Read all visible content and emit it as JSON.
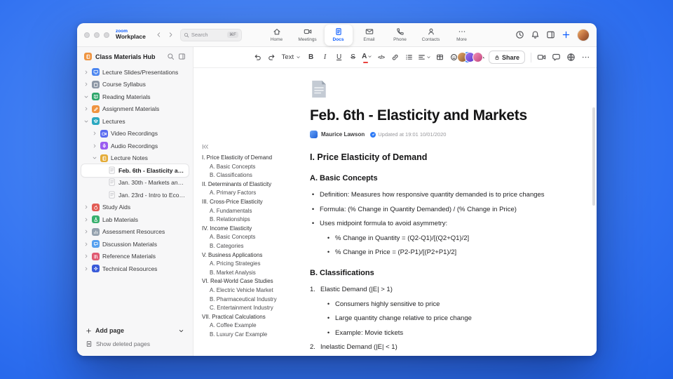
{
  "titlebar": {
    "brand_top": "zoom",
    "brand_bottom": "Workplace",
    "search": {
      "placeholder": "Search",
      "shortcut": "⌘F"
    },
    "tabs": [
      {
        "label": "Home",
        "icon": "home",
        "active": false
      },
      {
        "label": "Meetings",
        "icon": "meetings",
        "active": false
      },
      {
        "label": "Docs",
        "icon": "docs",
        "active": true
      },
      {
        "label": "Email",
        "icon": "email",
        "active": false
      },
      {
        "label": "Phone",
        "icon": "phone",
        "active": false
      },
      {
        "label": "Contacts",
        "icon": "contacts",
        "active": false
      },
      {
        "label": "More",
        "icon": "more",
        "active": false
      }
    ],
    "right_icons": [
      "history",
      "bell",
      "panel",
      "plus"
    ]
  },
  "sidebar": {
    "title": "Class Materials Hub",
    "items": [
      {
        "label": "Lecture Slides/Presentations",
        "indent": 0,
        "chevron": "right",
        "icon": {
          "kind": "monitor",
          "color": "#4c86f0"
        }
      },
      {
        "label": "Course Syllabus",
        "indent": 0,
        "chevron": "right",
        "icon": {
          "kind": "clipboard",
          "color": "#8d97a5"
        }
      },
      {
        "label": "Reading Materials",
        "indent": 0,
        "chevron": "down",
        "icon": {
          "kind": "book",
          "color": "#2ea66b"
        }
      },
      {
        "label": "Assignment Materials",
        "indent": 0,
        "chevron": "right",
        "icon": {
          "kind": "pencil",
          "color": "#ef9440"
        }
      },
      {
        "label": "Lectures",
        "indent": 0,
        "chevron": "down",
        "icon": {
          "kind": "cap",
          "color": "#2ba8c0"
        }
      },
      {
        "label": "Video Recordings",
        "indent": 1,
        "chevron": "right",
        "icon": {
          "kind": "camera",
          "color": "#5a6cf0"
        }
      },
      {
        "label": "Audio Recordings",
        "indent": 1,
        "chevron": "right",
        "icon": {
          "kind": "mic",
          "color": "#9a5cf0"
        }
      },
      {
        "label": "Lecture Notes",
        "indent": 1,
        "chevron": "down",
        "icon": {
          "kind": "notebook",
          "color": "#e4ac38"
        }
      },
      {
        "label": "Feb. 6th - Elasticity and M...",
        "indent": 2,
        "chevron": "none",
        "selected": true,
        "icon": {
          "kind": "page"
        }
      },
      {
        "label": "Jan. 30th - Markets and P...",
        "indent": 2,
        "chevron": "none",
        "icon": {
          "kind": "page"
        }
      },
      {
        "label": "Jan. 23rd - Intro to Econo...",
        "indent": 2,
        "chevron": "none",
        "icon": {
          "kind": "page"
        }
      },
      {
        "label": "Study Aids",
        "indent": 0,
        "chevron": "right",
        "icon": {
          "kind": "apple",
          "color": "#e25c55"
        }
      },
      {
        "label": "Lab Materials",
        "indent": 0,
        "chevron": "right",
        "icon": {
          "kind": "flask",
          "color": "#39b06e"
        }
      },
      {
        "label": "Assessment Resources",
        "indent": 0,
        "chevron": "right",
        "icon": {
          "kind": "chart",
          "color": "#93a0ad"
        }
      },
      {
        "label": "Discussion Materials",
        "indent": 0,
        "chevron": "right",
        "icon": {
          "kind": "chat",
          "color": "#56a0ef"
        }
      },
      {
        "label": "Reference Materials",
        "indent": 0,
        "chevron": "right",
        "icon": {
          "kind": "books",
          "color": "#e05a72"
        }
      },
      {
        "label": "Technical Resources",
        "indent": 0,
        "chevron": "right",
        "icon": {
          "kind": "gear",
          "color": "#3a5bd9"
        }
      }
    ],
    "footer": {
      "add_page": "Add page",
      "show_deleted": "Show deleted pages"
    }
  },
  "toolbar": {
    "text_style": "Text",
    "share": "Share",
    "buttons": [
      {
        "name": "undo",
        "type": "icon",
        "icon": "undo"
      },
      {
        "name": "redo",
        "type": "icon",
        "icon": "redo"
      },
      {
        "name": "text-style",
        "type": "select",
        "label": "Text"
      },
      {
        "name": "bold",
        "type": "text",
        "glyph": "B"
      },
      {
        "name": "italic",
        "type": "text",
        "glyph": "I"
      },
      {
        "name": "underline",
        "type": "text",
        "glyph": "U"
      },
      {
        "name": "strikethrough",
        "type": "text",
        "glyph": "S"
      },
      {
        "name": "text-color",
        "type": "text",
        "glyph": "A",
        "caret": true
      },
      {
        "name": "code",
        "type": "text",
        "glyph": "</>"
      },
      {
        "name": "link",
        "type": "icon",
        "icon": "link"
      },
      {
        "name": "bullet-list",
        "type": "icon",
        "icon": "list"
      },
      {
        "name": "align",
        "type": "icon",
        "icon": "align",
        "caret": true
      },
      {
        "name": "table",
        "type": "icon",
        "icon": "table"
      },
      {
        "name": "emoji",
        "type": "icon",
        "icon": "emoji"
      },
      {
        "name": "ai-companion",
        "type": "ai"
      },
      {
        "name": "collapse-toolbar",
        "type": "icon",
        "icon": "chev-up"
      }
    ],
    "right_icons": [
      "video",
      "comment",
      "globe",
      "more"
    ],
    "collaborator_count": 3
  },
  "toc": {
    "items": [
      {
        "label": "I. Price Elasticity of Demand",
        "level": 0
      },
      {
        "label": "A. Basic Concepts",
        "level": 1
      },
      {
        "label": "B. Classifications",
        "level": 1
      },
      {
        "label": "II. Determinants of Elasticity",
        "level": 0
      },
      {
        "label": "A. Primary Factors",
        "level": 1
      },
      {
        "label": "III. Cross-Price Elasticity",
        "level": 0
      },
      {
        "label": "A. Fundamentals",
        "level": 1
      },
      {
        "label": "B. Relationships",
        "level": 1
      },
      {
        "label": "IV. Income Elasticity",
        "level": 0
      },
      {
        "label": "A. Basic Concepts",
        "level": 1
      },
      {
        "label": "B. Categories",
        "level": 1
      },
      {
        "label": "V. Business Applications",
        "level": 0
      },
      {
        "label": "A. Pricing Strategies",
        "level": 1
      },
      {
        "label": "B. Market Analysis",
        "level": 1
      },
      {
        "label": "VI. Real-World Case Studies",
        "level": 0
      },
      {
        "label": "A. Electric Vehicle Market",
        "level": 1
      },
      {
        "label": "B. Pharmaceutical Industry",
        "level": 1
      },
      {
        "label": "C. Entertainment Industry",
        "level": 1
      },
      {
        "label": "VII. Practical Calculations",
        "level": 0
      },
      {
        "label": "A. Coffee Example",
        "level": 1
      },
      {
        "label": "B. Luxury Car Example",
        "level": 1
      }
    ]
  },
  "doc": {
    "title": "Feb. 6th - Elasticity and Markets",
    "author": "Maurice Lawson",
    "updated": "Updated at 19:01 10/01/2020",
    "blocks": [
      {
        "type": "h2",
        "text": "I. Price Elasticity of Demand"
      },
      {
        "type": "h3",
        "text": "A. Basic Concepts"
      },
      {
        "type": "bullet",
        "level": 0,
        "text": "Definition: Measures how responsive quantity demanded is to price changes"
      },
      {
        "type": "bullet",
        "level": 0,
        "text": "Formula: (% Change in Quantity Demanded) / (% Change in Price)"
      },
      {
        "type": "bullet",
        "level": 0,
        "text": "Uses midpoint formula to avoid asymmetry:"
      },
      {
        "type": "bullet",
        "level": 1,
        "text": "% Change in Quantity = (Q2-Q1)/[(Q2+Q1)/2]"
      },
      {
        "type": "bullet",
        "level": 1,
        "text": "% Change in Price = (P2-P1)/[(P2+P1)/2]"
      },
      {
        "type": "h3",
        "text": "B. Classifications"
      },
      {
        "type": "number",
        "num": "1.",
        "level": 0,
        "text": "Elastic Demand (|E| > 1)"
      },
      {
        "type": "bullet",
        "level": 1,
        "text": "Consumers highly sensitive to price"
      },
      {
        "type": "bullet",
        "level": 1,
        "text": "Large quantity change relative to price change"
      },
      {
        "type": "bullet",
        "level": 1,
        "text": "Example: Movie tickets"
      },
      {
        "type": "number",
        "num": "2.",
        "level": 0,
        "text": "Inelastic Demand (|E| < 1)"
      }
    ]
  }
}
